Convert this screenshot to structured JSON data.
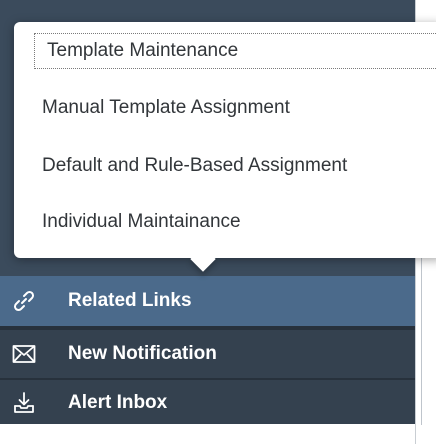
{
  "popover_menu": {
    "items": [
      {
        "label": "Template Maintenance",
        "focused": true
      },
      {
        "label": "Manual Template Assignment"
      },
      {
        "label": "Default and Rule-Based Assignment"
      },
      {
        "label": "Individual Maintainance"
      }
    ]
  },
  "side_nav": {
    "items": [
      {
        "label": "Related Links",
        "icon": "link-icon",
        "selected": true
      },
      {
        "label": "New Notification",
        "icon": "envelope-icon"
      },
      {
        "label": "Alert Inbox",
        "icon": "download-tray-icon"
      }
    ]
  },
  "colors": {
    "nav_selected": "#4b6a8b",
    "nav_background": "#34414f",
    "menu_text": "#32363a"
  }
}
